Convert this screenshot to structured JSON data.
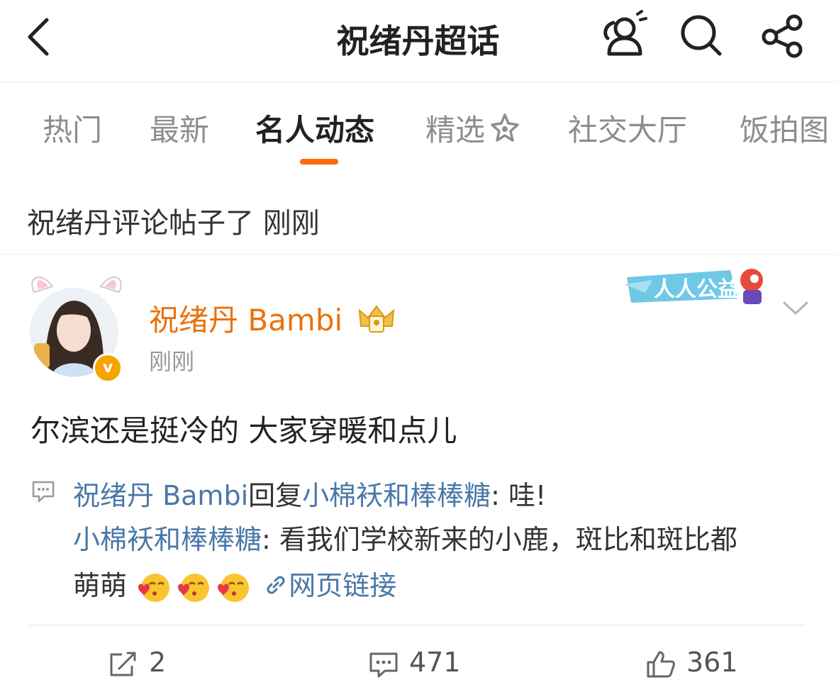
{
  "header": {
    "title": "祝绪丹超话",
    "back_icon": "chevron-left-icon",
    "right_icons": [
      "user-group-icon",
      "search-icon",
      "share-icon"
    ]
  },
  "tabs": [
    {
      "label": "热门",
      "active": false
    },
    {
      "label": "最新",
      "active": false
    },
    {
      "label": "名人动态",
      "active": true
    },
    {
      "label": "精选",
      "active": false
    },
    {
      "label": "社交大厅",
      "active": false
    },
    {
      "label": "饭拍图",
      "active": false
    }
  ],
  "status_line": "祝绪丹评论帖子了 刚刚",
  "post": {
    "author": "祝绪丹 Bambi",
    "time": "刚刚",
    "badge_text": "人人公益",
    "verified_mark": "v",
    "text": "尔滨还是挺冷的 大家穿暖和点儿",
    "comment": {
      "reply_author": "祝绪丹 Bambi",
      "reply_word": "回复",
      "reply_target": "小棉袄和棒棒糖",
      "reply_text": ": 哇!",
      "quoted_author": "小棉袄和棒棒糖",
      "quoted_text_1": ": 看我们学校新来的小鹿，斑比和斑比都",
      "quoted_text_2": "萌萌",
      "link_text": "网页链接"
    },
    "actions": {
      "repost_count": "2",
      "comment_count": "471",
      "like_count": "361"
    }
  },
  "colors": {
    "accent": "#ff6a00",
    "author": "#e8720c",
    "link": "#4a77a8"
  }
}
